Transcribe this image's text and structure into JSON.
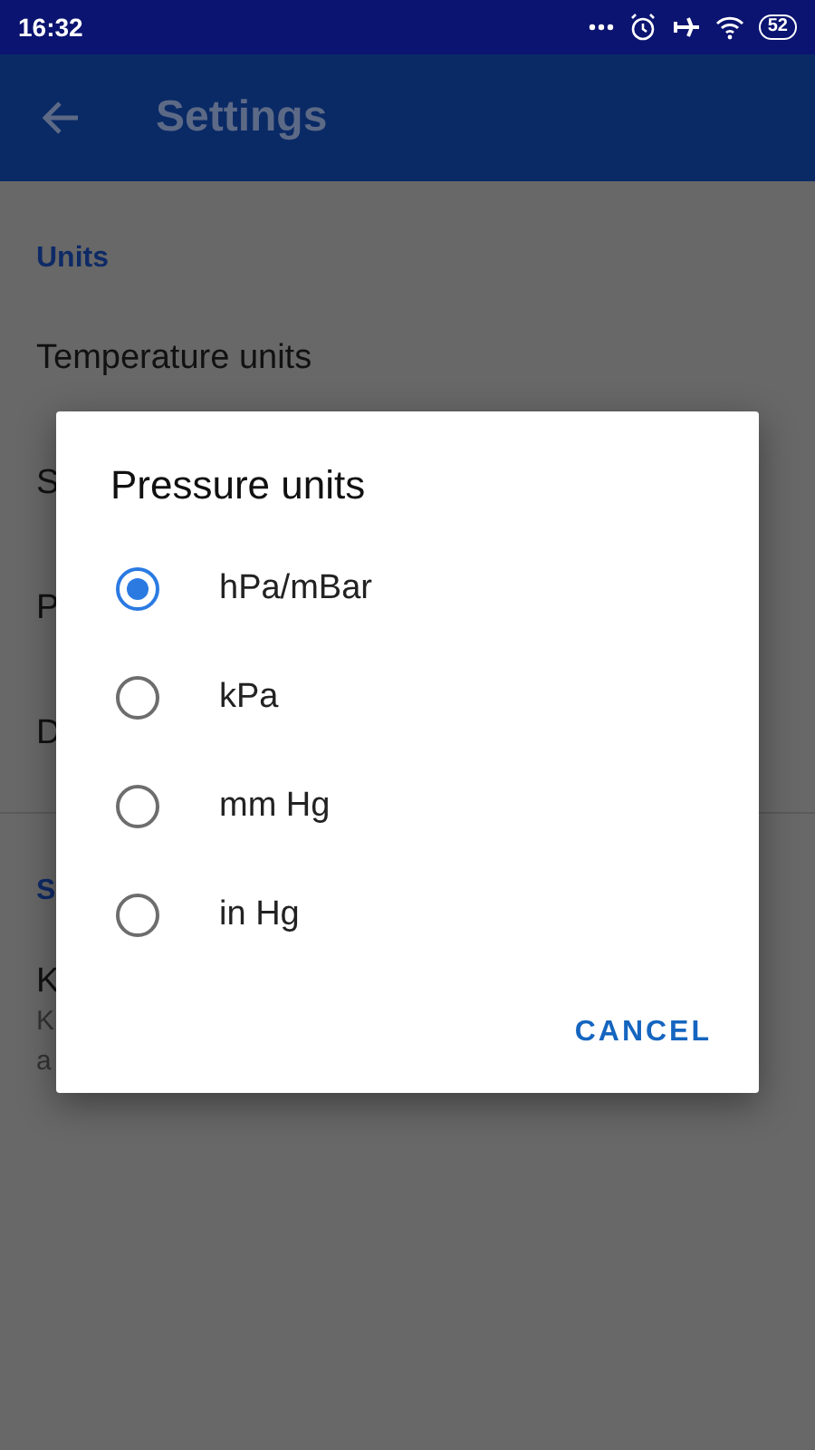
{
  "status_bar": {
    "time": "16:32",
    "battery": "52"
  },
  "app_bar": {
    "title": "Settings"
  },
  "sections": [
    {
      "header": "Units",
      "items": [
        {
          "title": "Temperature units"
        },
        {
          "title": "S"
        },
        {
          "title": "P"
        },
        {
          "title": "D"
        }
      ]
    },
    {
      "header": "S",
      "items": [
        {
          "title": "K",
          "subtitle": "K\na"
        }
      ]
    }
  ],
  "dialog": {
    "title": "Pressure units",
    "options": [
      {
        "label": "hPa/mBar",
        "selected": true
      },
      {
        "label": "kPa",
        "selected": false
      },
      {
        "label": "mm Hg",
        "selected": false
      },
      {
        "label": "in Hg",
        "selected": false
      }
    ],
    "button": "CANCEL"
  }
}
